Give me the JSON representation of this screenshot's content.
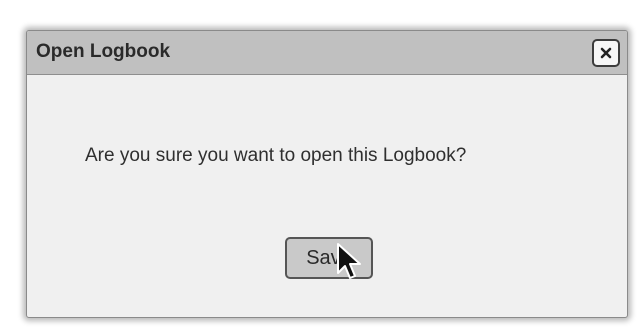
{
  "dialog": {
    "title": "Open Logbook",
    "close_icon": "close-icon",
    "message": "Are you sure you want to open this Logbook?",
    "save_label": "Save"
  },
  "cursor": {
    "icon": "mouse-pointer-icon"
  },
  "colors": {
    "titlebar": "#c0c0c0",
    "dialog_background": "#f0f0f0",
    "button_background": "#c9c9c9",
    "border": "#555555"
  }
}
